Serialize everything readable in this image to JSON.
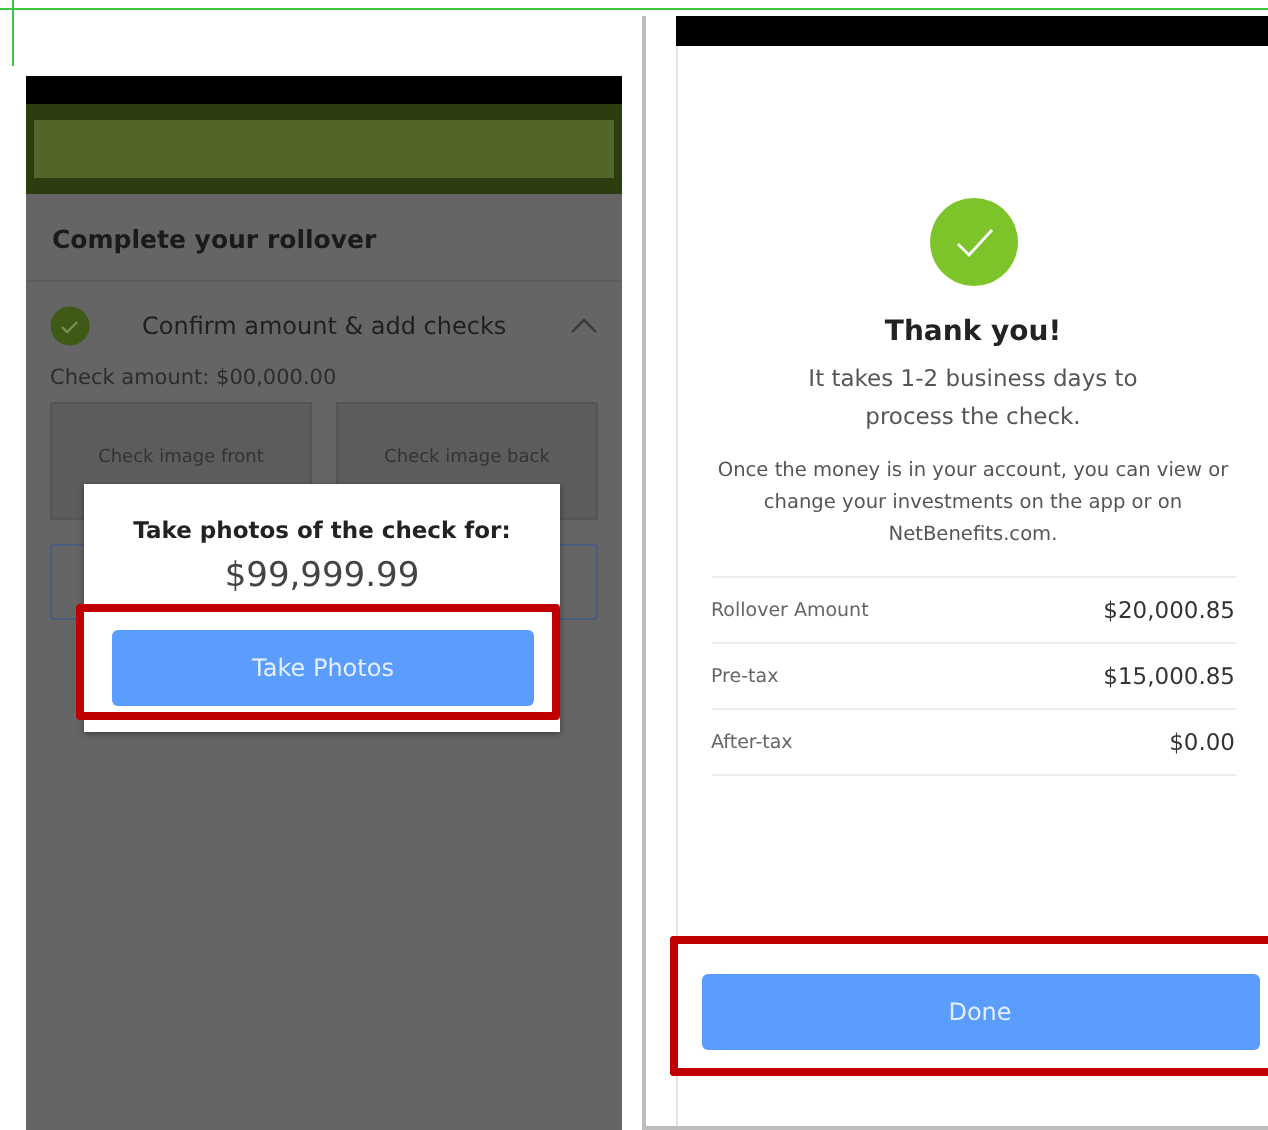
{
  "left_screen": {
    "title": "Complete your rollover",
    "step": {
      "title": "Confirm amount & add checks",
      "completed": true,
      "expanded": true
    },
    "check_amount": "Check amount: $00,000.00",
    "image_tiles": [
      "Check image front",
      "Check image back"
    ],
    "dialog": {
      "title": "Take photos of the check for:",
      "amount": "$99,999.99",
      "button": "Take Photos",
      "highlighted": true
    }
  },
  "right_screen": {
    "title": "Thank you!",
    "subtitle": "It takes 1-2 business days to process the check.",
    "note": "Once the money is in your account, you can view or change your investments on the app or on NetBenefits.com.",
    "summary": [
      {
        "label": "Rollover Amount",
        "value": "$20,000.85"
      },
      {
        "label": "Pre-tax",
        "value": "$15,000.85"
      },
      {
        "label": "After-tax",
        "value": "$0.00"
      }
    ],
    "button": "Done",
    "highlighted": true
  }
}
